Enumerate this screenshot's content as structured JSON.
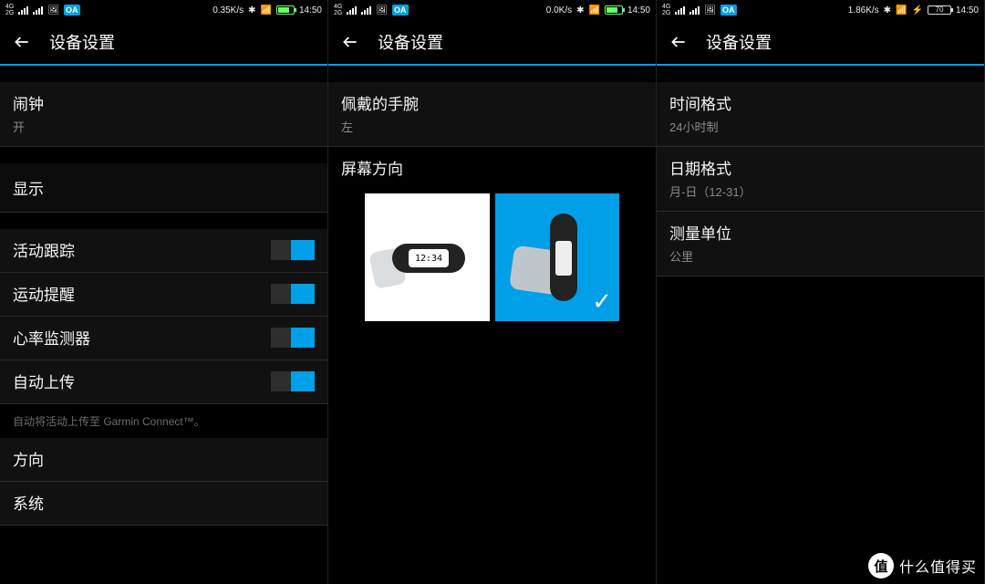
{
  "status": {
    "net": [
      "4G",
      "2G"
    ],
    "oa_badge": "OA",
    "time": "14:50",
    "speed1": "0.35K/s",
    "speed2": "0.0K/s",
    "speed3": "1.86K/s",
    "batt3": "70"
  },
  "header": {
    "title": "设备设置"
  },
  "screen1": {
    "alarm": {
      "label": "闹钟",
      "value": "开"
    },
    "display": {
      "label": "显示"
    },
    "activity_tracking": {
      "label": "活动跟踪"
    },
    "move_alert": {
      "label": "运动提醒"
    },
    "hrm": {
      "label": "心率监测器"
    },
    "auto_upload": {
      "label": "自动上传"
    },
    "auto_upload_desc": "自动将活动上传至 Garmin Connect™。",
    "orientation": {
      "label": "方向"
    },
    "system": {
      "label": "系统"
    }
  },
  "screen2": {
    "wrist": {
      "label": "佩戴的手腕",
      "value": "左"
    },
    "screen_orientation": {
      "label": "屏幕方向"
    },
    "band_time": "12:34"
  },
  "screen3": {
    "time_format": {
      "label": "时间格式",
      "value": "24小时制"
    },
    "date_format": {
      "label": "日期格式",
      "value": "月-日（12-31）"
    },
    "units": {
      "label": "测量单位",
      "value": "公里"
    }
  },
  "watermark": {
    "char": "值",
    "text": "什么值得买"
  }
}
